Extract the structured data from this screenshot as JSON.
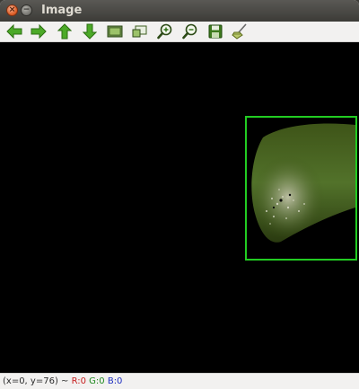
{
  "window": {
    "title": "Image",
    "close_glyph": "×",
    "minimize_glyph": "−"
  },
  "toolbar": {
    "buttons": [
      {
        "icon": "arrow-left-icon",
        "label": "Pan left"
      },
      {
        "icon": "arrow-right-icon",
        "label": "Pan right"
      },
      {
        "icon": "arrow-up-icon",
        "label": "Pan up"
      },
      {
        "icon": "arrow-down-icon",
        "label": "Pan down"
      },
      {
        "icon": "zoom-fit-icon",
        "label": "Zoom to fit"
      },
      {
        "icon": "zoom-window-icon",
        "label": "Zoom x1"
      },
      {
        "icon": "zoom-in-icon",
        "label": "Zoom in"
      },
      {
        "icon": "zoom-out-icon",
        "label": "Zoom out"
      },
      {
        "icon": "save-icon",
        "label": "Save"
      },
      {
        "icon": "properties-icon",
        "label": "Properties"
      }
    ]
  },
  "image": {
    "background_color": "#000000",
    "roi_color": "#22cc22",
    "object_color": "#4a6a1c"
  },
  "status": {
    "coords": "(x=0, y=76) ~",
    "r": "R:0",
    "g": "G:0",
    "b": "B:0"
  }
}
